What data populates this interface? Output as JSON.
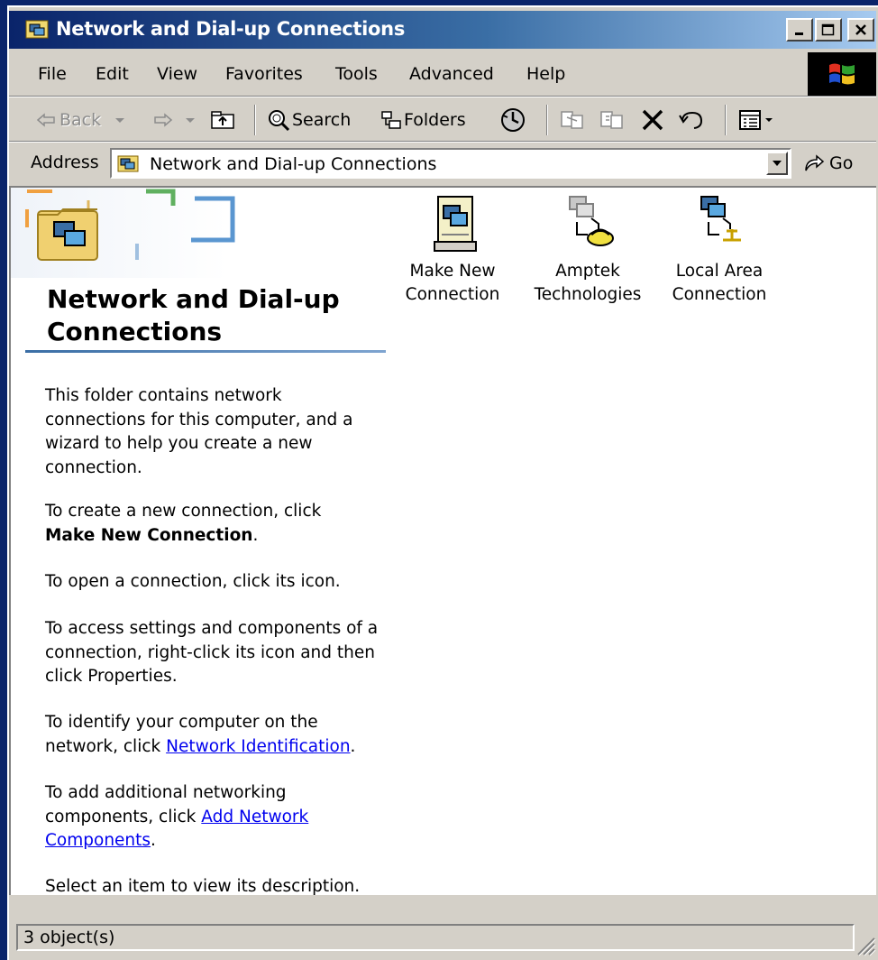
{
  "window": {
    "title": "Network and Dial-up Connections",
    "controls": {
      "minimize": "minimize",
      "maximize": "maximize",
      "close": "close"
    }
  },
  "menu": [
    "File",
    "Edit",
    "View",
    "Favorites",
    "Tools",
    "Advanced",
    "Help"
  ],
  "toolbar": {
    "back_label": "Back",
    "search_label": "Search",
    "folders_label": "Folders"
  },
  "address": {
    "label": "Address",
    "value": "Network and Dial-up Connections",
    "go_label": "Go"
  },
  "left_pane": {
    "title": "Network and Dial-up Connections",
    "para1": "This folder contains network connections for this computer, and a wizard to help you create a new connection.",
    "para2_prefix": "To create a new connection, click",
    "para2_bold": "Make New Connection",
    "para3": "To open a connection, click its icon.",
    "para4": "To access settings and components of a connection, right-click its icon and then click Properties.",
    "para5_prefix": "To identify your computer on the network, click",
    "para5_link": "Network Identification",
    "para6_prefix": "To add additional networking components, click",
    "para6_link": "Add Network Components",
    "para7": "Select an item to view its description."
  },
  "items": [
    {
      "line1": "Make New",
      "line2": "Connection",
      "icon": "make-new-connection-icon"
    },
    {
      "line1": "Amptek",
      "line2": "Technologies",
      "icon": "dialup-connection-icon"
    },
    {
      "line1": "Local Area",
      "line2": "Connection",
      "icon": "lan-connection-icon"
    }
  ],
  "status": {
    "text": "3 object(s)"
  },
  "colors": {
    "titlebar_start": "#0a246a",
    "titlebar_end": "#a6caf0",
    "face": "#d4d0c8",
    "link": "#0000ee"
  }
}
